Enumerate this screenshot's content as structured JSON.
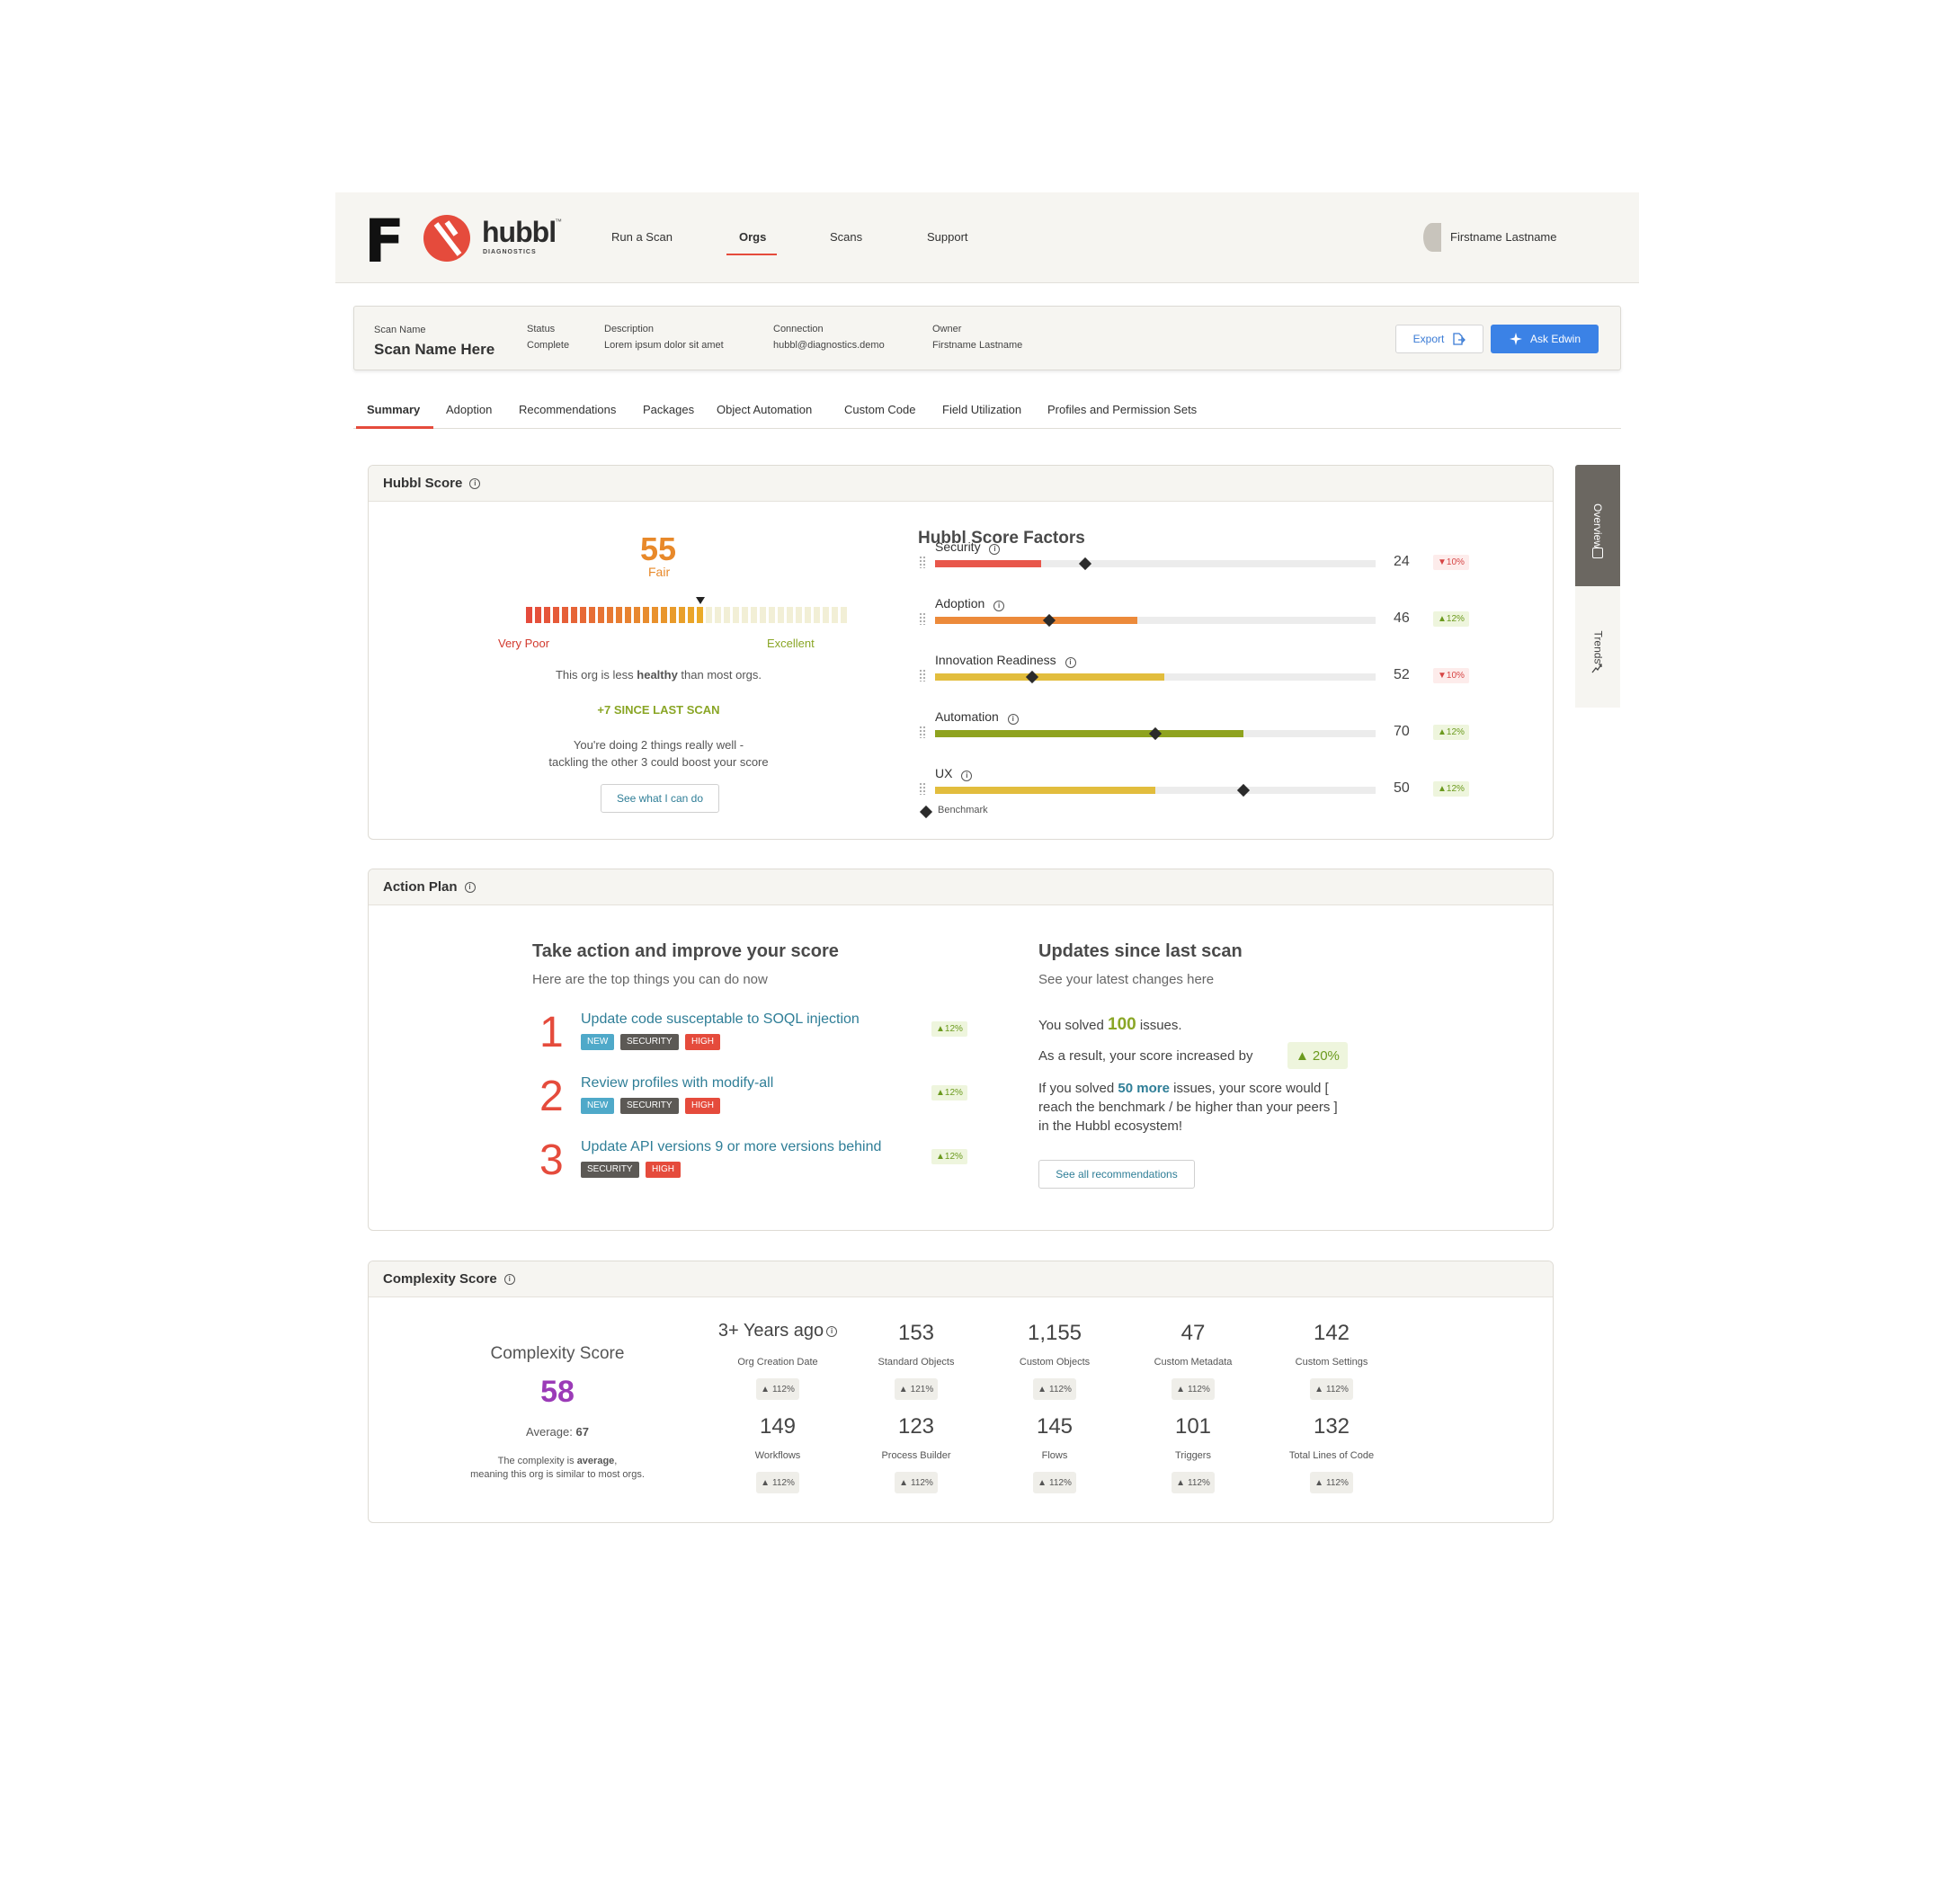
{
  "nav": {
    "brand_letter": "F",
    "logo_word": "hubbl",
    "logo_tm": "™",
    "logo_sub": "DIAGNOSTICS",
    "items": [
      "Run a Scan",
      "Orgs",
      "Scans",
      "Support"
    ],
    "active": "Orgs",
    "user_name": "Firstname Lastname"
  },
  "scan": {
    "name_label": "Scan Name",
    "name_value": "Scan Name Here",
    "status_label": "Status",
    "status_value": "Complete",
    "description_label": "Description",
    "description_value": "Lorem ipsum dolor sit amet",
    "connection_label": "Connection",
    "connection_value": "hubbl@diagnostics.demo",
    "owner_label": "Owner",
    "owner_value": "Firstname Lastname",
    "export_label": "Export",
    "ask_label": "Ask Edwin"
  },
  "tabs": [
    "Summary",
    "Adoption",
    "Recommendations",
    "Packages",
    "Object Automation",
    "Custom Code",
    "Field Utilization",
    "Profiles and Permission Sets"
  ],
  "side_tabs": {
    "overview": "Overview",
    "trends": "Trends"
  },
  "hubbl_score": {
    "title": "Hubbl Score",
    "score": "55",
    "rating": "Fair",
    "gauge_fraction": 0.55,
    "low_label": "Very Poor",
    "high_label": "Excellent",
    "summary_prefix": "This org is less ",
    "summary_bold": "healthy",
    "summary_suffix": " than most orgs.",
    "change": "+7 SINCE LAST SCAN",
    "doing_line1": "You're doing 2 things really well -",
    "doing_line2": "tackling the other 3 could boost your score",
    "cta": "See what I can do",
    "factors_title": "Hubbl Score Factors",
    "benchmark_label": "Benchmark",
    "factors": [
      {
        "name": "Security",
        "value": "24",
        "benchmark": 34,
        "change": "10%",
        "dir": "down",
        "color": "#e8574b"
      },
      {
        "name": "Adoption",
        "value": "46",
        "benchmark": 26,
        "change": "12%",
        "dir": "up",
        "color": "#ec8a3a"
      },
      {
        "name": "Innovation Readiness",
        "value": "52",
        "benchmark": 22,
        "change": "10%",
        "dir": "down",
        "color": "#e2bd3d"
      },
      {
        "name": "Automation",
        "value": "70",
        "benchmark": 50,
        "change": "12%",
        "dir": "up",
        "color": "#8fa31f"
      },
      {
        "name": "UX",
        "value": "50",
        "benchmark": 70,
        "change": "12%",
        "dir": "up",
        "color": "#e2bd3d"
      }
    ]
  },
  "action_plan": {
    "title": "Action Plan",
    "left_heading": "Take action and improve your score",
    "left_sub": "Here are the top things you can do now",
    "items": [
      {
        "num": "1",
        "text": "Update code susceptable to SOQL injection",
        "tags": [
          "NEW",
          "SECURITY",
          "HIGH"
        ],
        "change": "12%"
      },
      {
        "num": "2",
        "text": "Review profiles with modify-all",
        "tags": [
          "NEW",
          "SECURITY",
          "HIGH"
        ],
        "change": "12%"
      },
      {
        "num": "3",
        "text": "Update API versions 9 or more versions behind",
        "tags": [
          "SECURITY",
          "HIGH"
        ],
        "change": "12%"
      }
    ],
    "right_heading": "Updates since last scan",
    "right_sub": "See your latest changes here",
    "solved_prefix": "You solved ",
    "solved_count": "100",
    "solved_suffix": " issues.",
    "result_text": "As a result, your score increased by",
    "result_change": "20%",
    "if_prefix": "If you solved ",
    "if_bold": "50 more",
    "if_line1_suffix": " issues, your score would [",
    "if_line2": "reach the benchmark / be higher than your peers ]",
    "if_line3": "in the Hubbl ecosystem!",
    "cta": "See all recommendations"
  },
  "complexity": {
    "title": "Complexity Score",
    "heading": "Complexity Score",
    "score": "58",
    "average_label": "Average: ",
    "average_value": "67",
    "desc_prefix": "The complexity is ",
    "desc_bold": "average",
    "desc_suffix": ",",
    "desc_line2": "meaning this org is similar to most orgs.",
    "metrics": [
      {
        "value": "3+ Years ago",
        "label": "Org Creation Date",
        "change": "112%",
        "info": true
      },
      {
        "value": "153",
        "label": "Standard Objects",
        "change": "121%"
      },
      {
        "value": "1,155",
        "label": "Custom Objects",
        "change": "112%"
      },
      {
        "value": "47",
        "label": "Custom Metadata",
        "change": "112%"
      },
      {
        "value": "142",
        "label": "Custom Settings",
        "change": "112%"
      },
      {
        "value": "149",
        "label": "Workflows",
        "change": "112%"
      },
      {
        "value": "123",
        "label": "Process Builder",
        "change": "112%"
      },
      {
        "value": "145",
        "label": "Flows",
        "change": "112%"
      },
      {
        "value": "101",
        "label": "Triggers",
        "change": "112%"
      },
      {
        "value": "132",
        "label": "Total Lines of Code",
        "change": "112%"
      }
    ]
  }
}
